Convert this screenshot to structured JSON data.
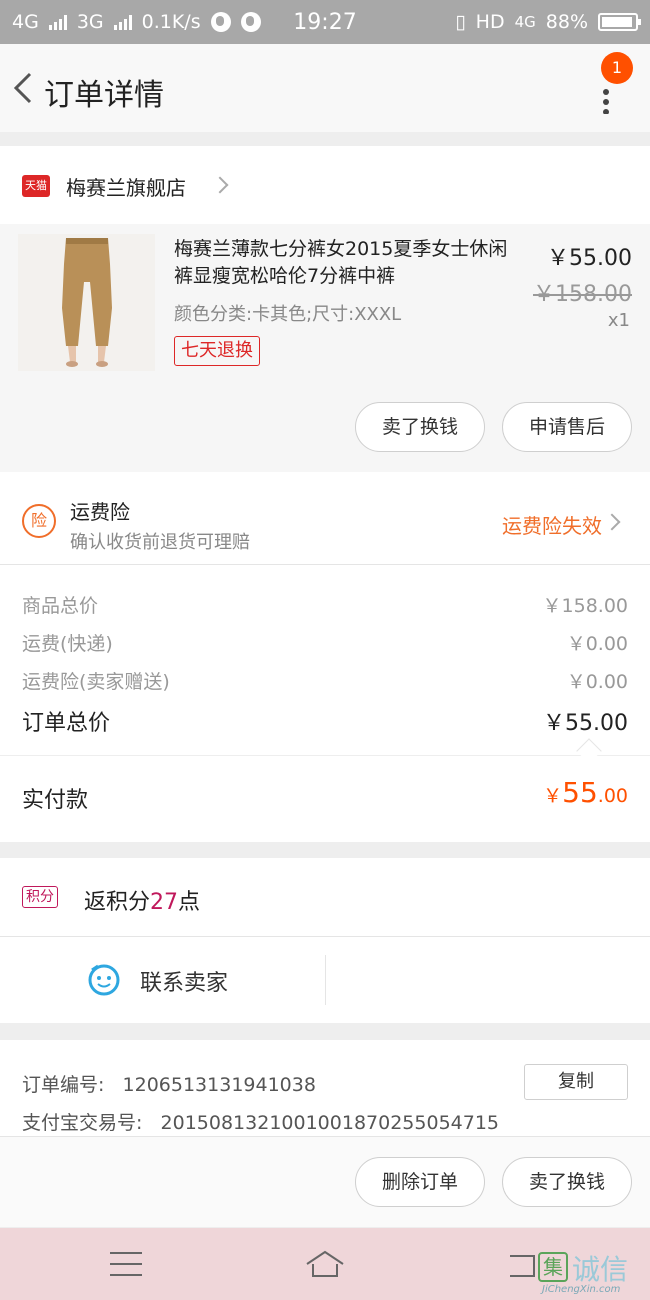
{
  "status_bar": {
    "net1": "4G",
    "net2": "3G",
    "speed": "0.1K/s",
    "time": "19:27",
    "hd": "HD",
    "net3": "4G",
    "battery": "88%"
  },
  "header": {
    "title": "订单详情",
    "notification_count": "1"
  },
  "store": {
    "badge": "天猫",
    "name": "梅赛兰旗舰店"
  },
  "product": {
    "title": "梅赛兰薄款七分裤女2015夏季女士休闲裤显瘦宽松哈伦7分裤中裤",
    "sku": "颜色分类:卡其色;尺寸:XXXL",
    "return_policy": "七天退换",
    "price": "￥55.00",
    "original_price": "￥158.00",
    "quantity": "x1",
    "btn_resell": "卖了换钱",
    "btn_aftersale": "申请售后"
  },
  "insurance": {
    "icon_text": "险",
    "title": "运费险",
    "subtitle": "确认收货前退货可理赔",
    "status": "运费险失效"
  },
  "breakdown": {
    "rows": [
      {
        "label": "商品总价",
        "value": "￥158.00"
      },
      {
        "label": "运费(快递)",
        "value": "￥0.00"
      },
      {
        "label": "运费险(卖家赠送)",
        "value": "￥0.00"
      }
    ],
    "total_label": "订单总价",
    "total_value": "￥55.00",
    "paid_label": "实付款",
    "paid_currency": "￥",
    "paid_int": "55",
    "paid_dec": ".00"
  },
  "points": {
    "badge": "积分",
    "prefix": "返积分",
    "amount": "27",
    "suffix": "点"
  },
  "contact": {
    "label": "联系卖家"
  },
  "order_info": {
    "order_no_label": "订单编号:",
    "order_no": "1206513131941038",
    "alipay_label": "支付宝交易号:",
    "alipay_no": "2015081321001001870255054715",
    "copy": "复制"
  },
  "actions": {
    "delete": "删除订单",
    "resell": "卖了换钱"
  },
  "watermark": {
    "box": "集",
    "text": "诚信",
    "url": "JiChengXin.com"
  },
  "colors": {
    "accent": "#ff5000",
    "tmall_red": "#dd2727",
    "points_magenta": "#c0185b",
    "insurance_orange": "#f06e2a"
  }
}
